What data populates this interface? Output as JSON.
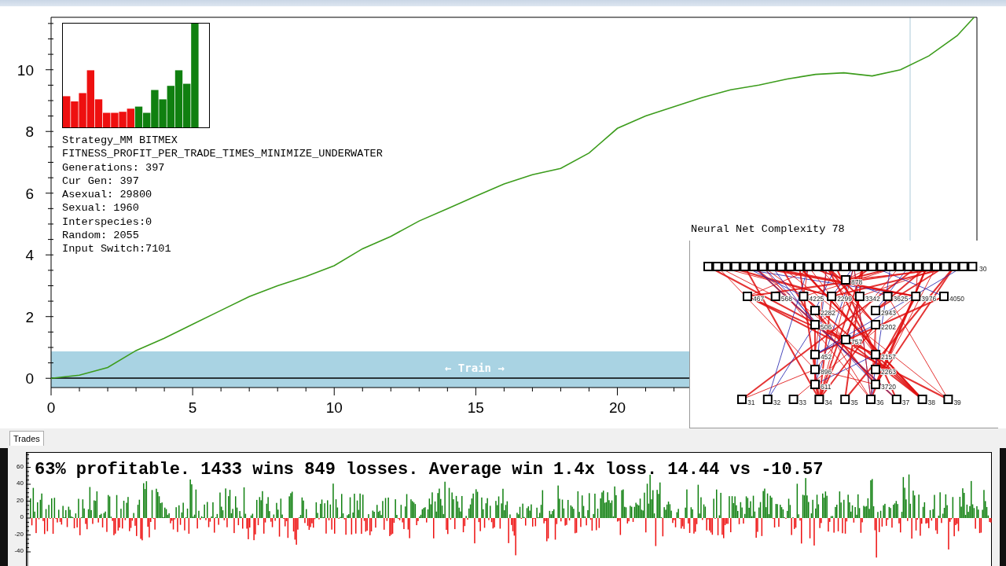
{
  "equity_chart": {
    "chart_data": {
      "type": "line",
      "x": [
        0,
        1,
        2,
        3,
        4,
        5,
        6,
        7,
        8,
        9,
        10,
        11,
        12,
        13,
        14,
        15,
        16,
        17,
        18,
        19,
        20,
        21,
        22,
        23,
        24,
        25,
        26,
        27,
        28,
        29,
        30,
        31,
        32,
        32.6
      ],
      "series": [
        {
          "color": "#3c9c1c",
          "values": [
            0,
            0.1,
            0.35,
            0.9,
            1.3,
            1.75,
            2.2,
            2.65,
            3.0,
            3.3,
            3.65,
            4.2,
            4.6,
            5.1,
            5.5,
            5.9,
            6.3,
            6.6,
            6.8,
            7.3,
            8.1,
            8.5,
            8.8,
            9.1,
            9.35,
            9.5,
            9.7,
            9.85,
            9.9,
            9.8,
            10.0,
            10.45,
            11.1,
            11.7
          ]
        }
      ],
      "xlim": [
        0,
        32.7
      ],
      "ylim": [
        -0.3,
        11.7
      ],
      "xticks": [
        0,
        5,
        10,
        15,
        20
      ],
      "yticks": [
        0,
        2,
        4,
        6,
        8,
        10
      ]
    },
    "train_band": {
      "label": "← Train →"
    }
  },
  "stats": {
    "lines": [
      "Strategy_MM BITMEX",
      "FITNESS_PROFIT_PER_TRADE_TIMES_MINIMIZE_UNDERWATER",
      "Generations: 397",
      "Cur Gen: 397",
      "Asexual: 29800",
      "Sexual: 1960",
      "Interspecies:0",
      "Random: 2055",
      "Input Switch:7101"
    ]
  },
  "neural_net": {
    "title": "Neural Net Complexity 78",
    "input_row": {
      "last_label": "30"
    },
    "hidden_rows": [
      [
        "878"
      ],
      [
        "467",
        "568",
        "4225",
        "2299",
        "3342",
        "3625",
        "3976",
        "4050"
      ],
      [
        "2282",
        "2943"
      ],
      [
        "506",
        "2202"
      ],
      [
        "757"
      ],
      [
        "452",
        "2157"
      ],
      [
        "896",
        "2263"
      ],
      [
        "611",
        "3720"
      ]
    ],
    "outputs": [
      "31",
      "32",
      "33",
      "34",
      "35",
      "36",
      "37",
      "38",
      "39"
    ]
  },
  "tabs": [
    {
      "label": "Trades",
      "selected": true
    }
  ],
  "trades": {
    "summary": "63% profitable. 1433 wins 849 losses. Average win 1.4x loss. 14.44 vs -10.57",
    "y_tick_labels": [
      "60",
      "40",
      "20",
      "0",
      "-20",
      "-40"
    ]
  }
}
